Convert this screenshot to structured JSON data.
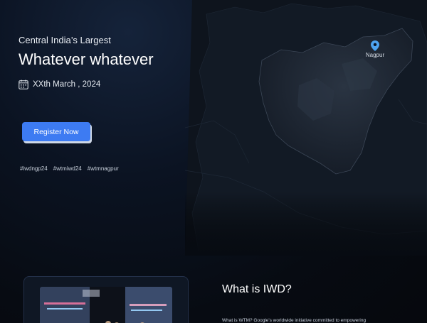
{
  "hero": {
    "eyebrow": "Central India’s Largest",
    "headline": "Whatever whatever",
    "date_icon": "calendar-icon",
    "date": "XXth March , 2024",
    "register_label": "Register Now",
    "hashtags": [
      "#iwdngp24",
      "#wtmiwd24",
      "#wtmnagpur"
    ]
  },
  "map": {
    "pin_icon": "location-pin-icon",
    "pin_label": "Nagpur",
    "pin_color": "#4da3f0"
  },
  "about": {
    "title": "What is IWD?",
    "body": "What is WTM?  Google's worldwide initiative committed to empowering"
  },
  "colors": {
    "accent": "#3d7bf2",
    "background": "#070b12"
  }
}
